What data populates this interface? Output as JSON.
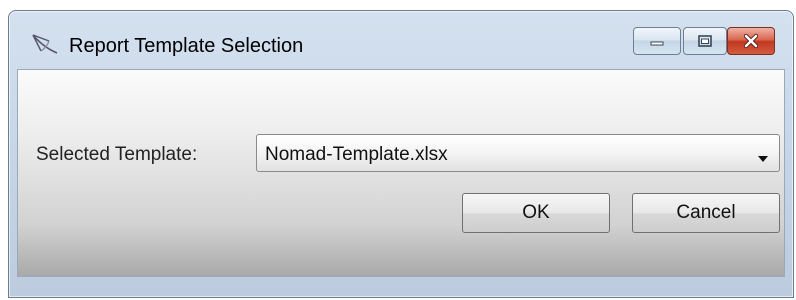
{
  "window": {
    "title": "Report Template Selection",
    "icon": "satellite-dish-icon"
  },
  "caption_buttons": {
    "minimize": "minimize-icon",
    "maximize": "maximize-icon",
    "close": "close-icon",
    "close_color": "#c0391f"
  },
  "form": {
    "template_label": "Selected Template:",
    "template_value": "Nomad-Template.xlsx"
  },
  "buttons": {
    "ok_label": "OK",
    "cancel_label": "Cancel"
  }
}
